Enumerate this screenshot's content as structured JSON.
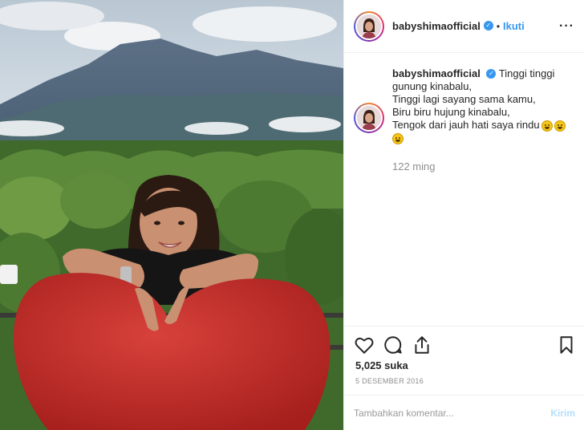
{
  "post": {
    "username": "babyshimaofficial",
    "verified_icon": "verified-badge-icon",
    "separator": "•",
    "follow_label": "Ikuti",
    "more_icon": "more-options-icon",
    "caption_lines": [
      "Tinggi tinggi",
      "gunung kinabalu,",
      "Tinggi lagi sayang sama kamu,",
      "Biru biru hujung kinabalu,",
      "Tengok dari jauh hati saya rindu"
    ],
    "time_ago": "122 ming",
    "likes": "5,025 suka",
    "date": "5 DESEMBER 2016"
  },
  "comment": {
    "placeholder": "Tambahkan komentar...",
    "post_label": "Kirim"
  },
  "icons": {
    "like": "heart-icon",
    "comment": "comment-icon",
    "share": "share-icon",
    "save": "bookmark-icon"
  },
  "colors": {
    "accent": "#3897f0",
    "text": "#262626",
    "muted": "#8e8e8e",
    "post_disabled": "#b2dffc"
  }
}
